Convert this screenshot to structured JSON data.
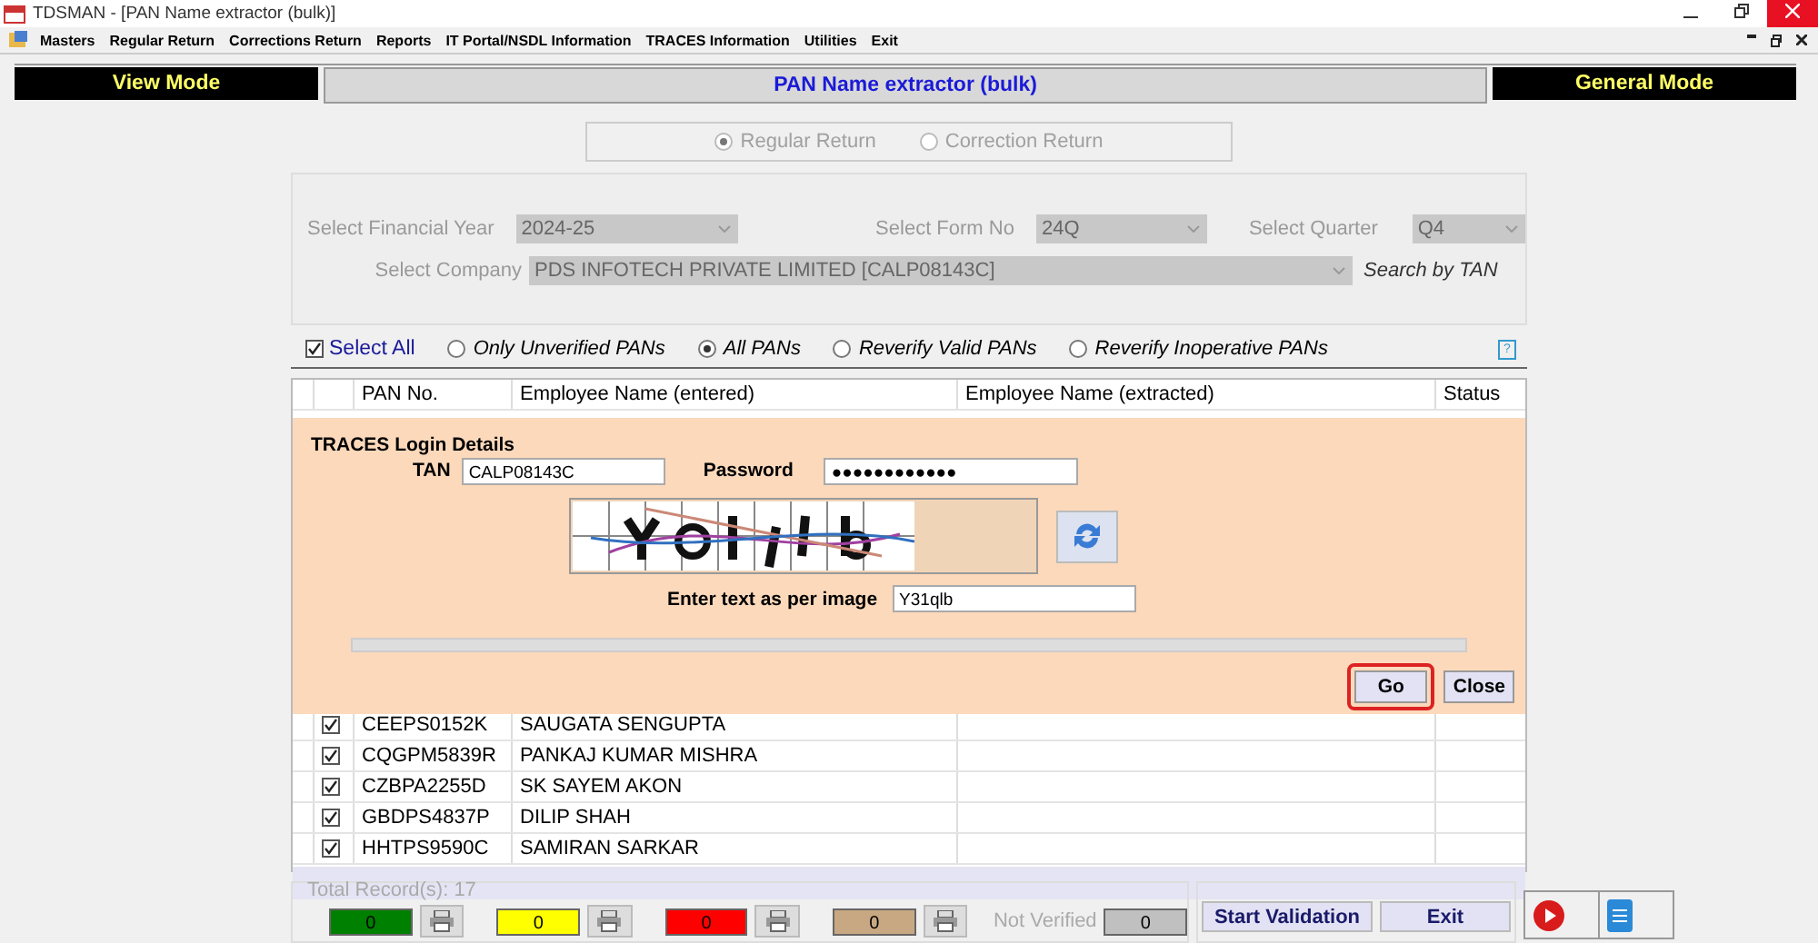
{
  "window": {
    "title": "TDSMAN - [PAN Name extractor (bulk)]"
  },
  "menu": [
    "Masters",
    "Regular Return",
    "Corrections Return",
    "Reports",
    "IT Portal/NSDL Information",
    "TRACES Information",
    "Utilities",
    "Exit"
  ],
  "mode_bar": {
    "left": "View Mode",
    "title": "PAN Name extractor (bulk)",
    "right": "General Mode"
  },
  "return_type": [
    {
      "label": "Regular Return",
      "selected": true
    },
    {
      "label": "Correction Return",
      "selected": false
    }
  ],
  "selection": {
    "fields": [
      {
        "label": "Select Financial Year",
        "value": "2024-25"
      },
      {
        "label": "Select Form No",
        "value": "24Q"
      },
      {
        "label": "Select Quarter",
        "value": "Q4"
      },
      {
        "label": "Select Company",
        "value": "PDS INFOTECH PRIVATE LIMITED [CALP08143C]"
      }
    ],
    "search_link": "Search by TAN"
  },
  "filters": {
    "help": "?",
    "select_all": {
      "label": "Select All",
      "checked": true
    },
    "options": [
      {
        "label": "Only Unverified PANs",
        "selected": false
      },
      {
        "label": "All PANs",
        "selected": true
      },
      {
        "label": "Reverify Valid PANs",
        "selected": false
      },
      {
        "label": "Reverify Inoperative PANs",
        "selected": false
      }
    ]
  },
  "table": {
    "columns": [
      "PAN No.",
      "Employee Name (entered)",
      "Employee Name (extracted)",
      "Status"
    ],
    "rows": [
      {
        "pan": "CEEPS0152K",
        "name": "SAUGATA SENGUPTA",
        "checked": true
      },
      {
        "pan": "CQGPM5839R",
        "name": "PANKAJ  KUMAR MISHRA",
        "checked": true
      },
      {
        "pan": "CZBPA2255D",
        "name": "SK SAYEM AKON",
        "checked": true
      },
      {
        "pan": "GBDPS4837P",
        "name": "DILIP SHAH",
        "checked": true
      },
      {
        "pan": "HHTPS9590C",
        "name": "SAMIRAN SARKAR",
        "checked": true
      }
    ]
  },
  "dialog": {
    "title": "TRACES Login Details",
    "tan_label": "TAN",
    "tan": "CALP08143C",
    "password_label": "Password",
    "password": "●●●●●●●●●●●●",
    "captcha_label": "Enter text as per image",
    "captcha_value": "Y31qlb",
    "progress": {
      "level": 0
    },
    "buttons": [
      {
        "label": "Go",
        "highlighted": true
      },
      {
        "label": "Close",
        "highlighted": false
      }
    ]
  },
  "footer": {
    "total": "Total Record(s): 17",
    "counters": [
      {
        "value": "0",
        "color": "#008000"
      },
      {
        "value": "0",
        "color": "#ffff00"
      },
      {
        "value": "0",
        "color": "#ff0000"
      },
      {
        "value": "0",
        "color": "#c8a882"
      }
    ],
    "not_verified_label": "Not Verified",
    "not_verified": "0",
    "buttons": [
      "Start Validation",
      "Exit"
    ]
  }
}
